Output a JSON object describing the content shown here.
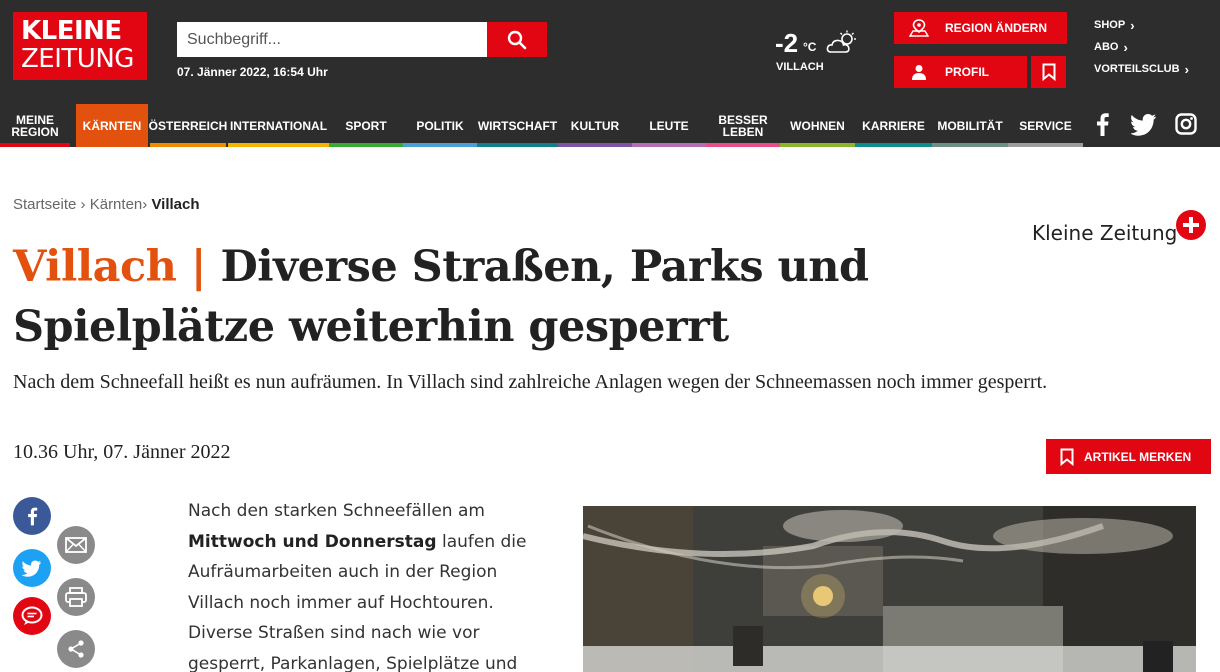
{
  "logo": {
    "line1": "KLEINE",
    "line2": "ZEITUNG"
  },
  "search": {
    "placeholder": "Suchbegriff..."
  },
  "date": "07. Jänner 2022, 16:54 Uhr",
  "weather": {
    "temp": "-2",
    "unit": "°C",
    "city": "VILLACH",
    "icon": "partly-cloudy-icon"
  },
  "header_buttons": {
    "region": "REGION ÄNDERN",
    "profil": "PROFIL"
  },
  "toplinks": [
    "SHOP",
    "ABO",
    "VORTEILSCLUB"
  ],
  "nav": [
    {
      "label": "MEINE REGION",
      "color": "#e20613"
    },
    {
      "label": "KÄRNTEN",
      "color": "#e2520e",
      "active": true
    },
    {
      "label": "ÖSTERREICH",
      "color": "#f08a00"
    },
    {
      "label": "INTERNATIONAL",
      "color": "#f5b400"
    },
    {
      "label": "SPORT",
      "color": "#3aa935"
    },
    {
      "label": "POLITIK",
      "color": "#4c9fd6"
    },
    {
      "label": "WIRTSCHAFT",
      "color": "#137f8a"
    },
    {
      "label": "KULTUR",
      "color": "#7b54a6"
    },
    {
      "label": "LEUTE",
      "color": "#b66bb3"
    },
    {
      "label": "BESSER LEBEN",
      "color": "#e94e8b"
    },
    {
      "label": "WOHNEN",
      "color": "#8bb52c"
    },
    {
      "label": "KARRIERE",
      "color": "#0f8c8c"
    },
    {
      "label": "MOBILITÄT",
      "color": "#6e8f85"
    },
    {
      "label": "SERVICE",
      "color": "#9c9c9c"
    }
  ],
  "social_icons": [
    "facebook-icon",
    "twitter-icon",
    "instagram-icon"
  ],
  "breadcrumb": {
    "home": "Startseite",
    "sep": "›",
    "section": "Kärnten",
    "current": "Villach"
  },
  "follow": {
    "label": "Kleine Zeitung"
  },
  "article": {
    "location": "Villach",
    "separator": " | ",
    "title": "Diverse Straßen, Parks und Spielplätze weiterhin gesperrt",
    "lead": "Nach dem Schneefall heißt es nun aufräumen. In Villach sind zahlreiche Anlagen wegen der Schneemassen noch immer gesperrt.",
    "published": "10.36 Uhr, 07. Jänner 2022",
    "save_label": "ARTIKEL MERKEN",
    "body_pre": "Nach den starken Schneefällen am ",
    "body_bold": "Mittwoch und Donnerstag",
    "body_post": " laufen die Aufräumarbeiten auch in der Region Villach noch immer auf Hochtouren. Diverse Straßen sind nach wie vor gesperrt, Parkanlagen, Spielplätze und"
  },
  "colors": {
    "brand": "#e20613",
    "accent": "#e2520e",
    "header_bg": "#2d2d2d"
  }
}
